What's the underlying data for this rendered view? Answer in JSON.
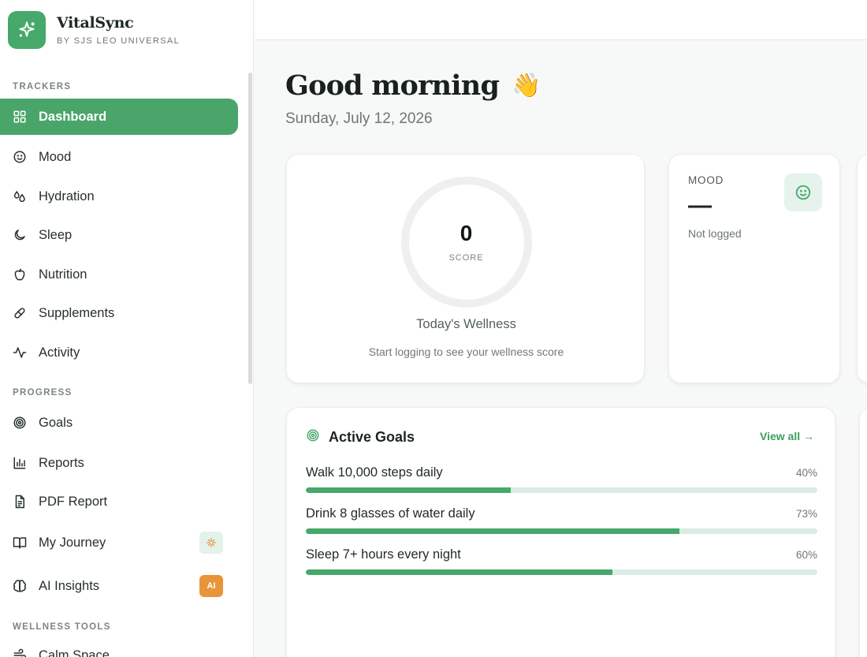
{
  "brand": {
    "name": "VitalSync",
    "subtitle": "BY SJS LEO UNIVERSAL",
    "logo_icon": "sparkle-icon"
  },
  "sidebar": {
    "sections": [
      {
        "label": "TRACKERS",
        "items": [
          {
            "label": "Dashboard",
            "icon": "grid-icon",
            "active": true
          },
          {
            "label": "Mood",
            "icon": "smile-icon"
          },
          {
            "label": "Hydration",
            "icon": "droplets-icon"
          },
          {
            "label": "Sleep",
            "icon": "moon-icon"
          },
          {
            "label": "Nutrition",
            "icon": "apple-icon"
          },
          {
            "label": "Supplements",
            "icon": "pill-icon"
          },
          {
            "label": "Activity",
            "icon": "activity-icon"
          }
        ]
      },
      {
        "label": "PROGRESS",
        "items": [
          {
            "label": "Goals",
            "icon": "target-icon"
          },
          {
            "label": "Reports",
            "icon": "bar-chart-icon"
          },
          {
            "label": "PDF Report",
            "icon": "file-icon"
          },
          {
            "label": "My Journey",
            "icon": "book-icon",
            "badge": "sparkle"
          },
          {
            "label": "AI Insights",
            "icon": "brain-icon",
            "badge": "AI"
          }
        ]
      },
      {
        "label": "WELLNESS TOOLS",
        "items": [
          {
            "label": "Calm Space",
            "icon": "wind-icon"
          }
        ]
      }
    ]
  },
  "header": {
    "greeting": "Good morning",
    "wave": "👋",
    "date": "Sunday, July 12, 2026"
  },
  "wellness": {
    "score": "0",
    "score_label": "SCORE",
    "title": "Today's Wellness",
    "hint": "Start logging to see your wellness score"
  },
  "mood": {
    "label": "MOOD",
    "value": "—",
    "status": "Not logged"
  },
  "goals": {
    "title": "Active Goals",
    "view_all": "View all →",
    "items": [
      {
        "name": "Walk 10,000 steps daily",
        "pct_label": "40%",
        "progress": 40
      },
      {
        "name": "Drink 8 glasses of water daily",
        "pct_label": "73%",
        "progress": 73
      },
      {
        "name": "Sleep 7+ hours every night",
        "pct_label": "60%",
        "progress": 60
      }
    ]
  },
  "colors": {
    "accent": "#46a86b",
    "accent_light": "#dcece3",
    "badge_orange": "#e8953a"
  }
}
